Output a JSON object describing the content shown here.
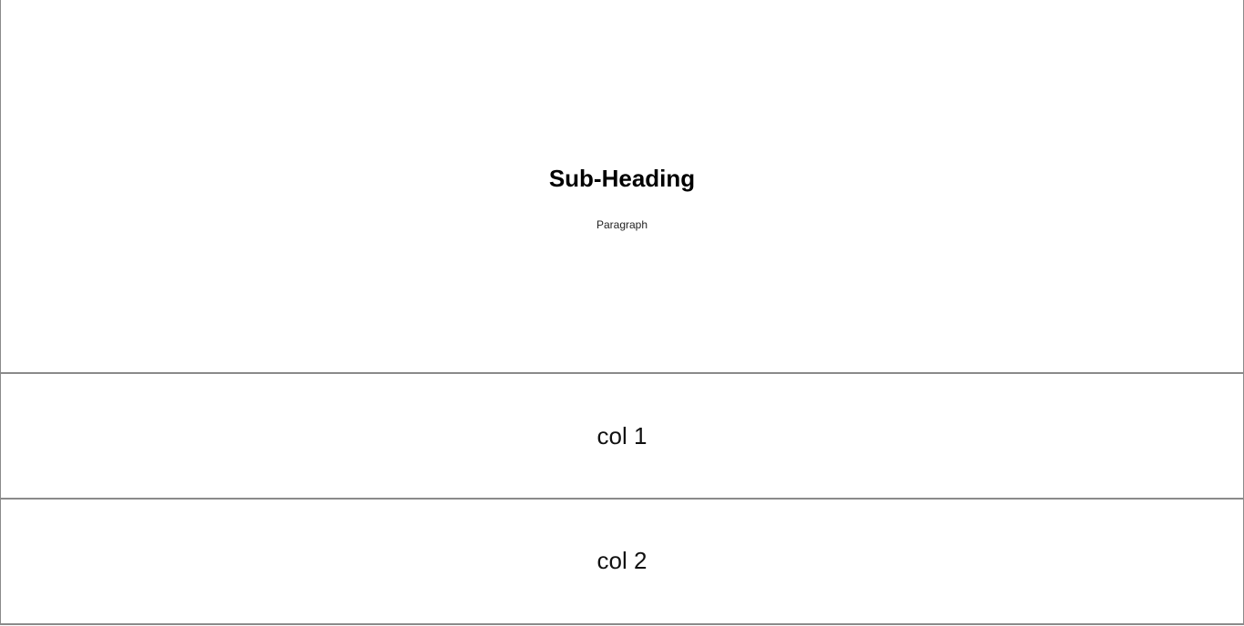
{
  "hero": {
    "sub_heading": "Sub-Heading",
    "paragraph": "Paragraph"
  },
  "columns": [
    {
      "label": "col 1"
    },
    {
      "label": "col 2"
    }
  ],
  "colors": {
    "background": "#ffffff",
    "border": "#8a8a8a",
    "text": "#000000"
  }
}
